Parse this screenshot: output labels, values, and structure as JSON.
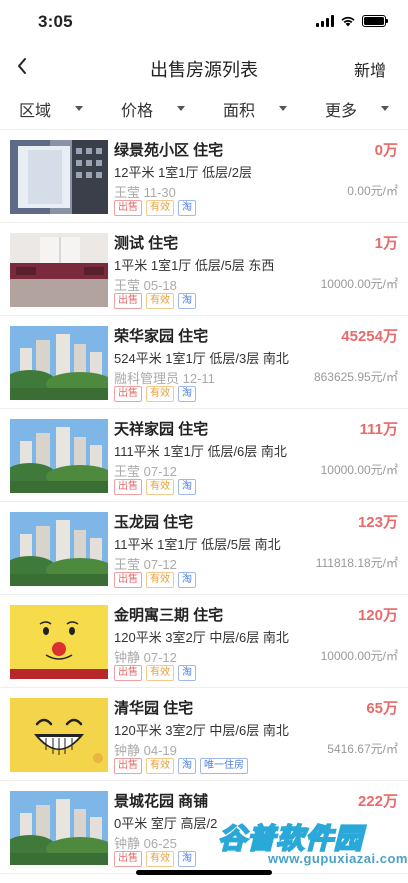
{
  "status": {
    "time": "3:05"
  },
  "nav": {
    "title": "出售房源列表",
    "action": "新增"
  },
  "filters": [
    "区域",
    "价格",
    "面积",
    "更多"
  ],
  "listings": [
    {
      "title": "绿景苑小区 住宅",
      "price": "0万",
      "spec": "12平米 1室1厅 低层/2层",
      "agent": "王莹 11-30",
      "unit_price": "0.00元/㎡",
      "tags": [
        "出售",
        "有效",
        "淘"
      ],
      "thumb": "room-photo"
    },
    {
      "title": "测试 住宅",
      "price": "1万",
      "spec": "1平米 1室1厅 低层/5层 东西",
      "agent": "王莹 05-18",
      "unit_price": "10000.00元/㎡",
      "tags": [
        "出售",
        "有效",
        "淘"
      ],
      "thumb": "interior-photo"
    },
    {
      "title": "荣华家园 住宅",
      "price": "45254万",
      "spec": "524平米 1室1厅 低层/3层 南北",
      "agent": "融科管理员 12-11",
      "unit_price": "863625.95元/㎡",
      "tags": [
        "出售",
        "有效",
        "淘"
      ],
      "thumb": "building-photo"
    },
    {
      "title": "天祥家园 住宅",
      "price": "111万",
      "spec": "111平米 1室1厅 低层/6层 南北",
      "agent": "王莹 07-12",
      "unit_price": "10000.00元/㎡",
      "tags": [
        "出售",
        "有效",
        "淘"
      ],
      "thumb": "building-photo"
    },
    {
      "title": "玉龙园 住宅",
      "price": "123万",
      "spec": "11平米 1室1厅 低层/5层 南北",
      "agent": "王莹 07-12",
      "unit_price": "111818.18元/㎡",
      "tags": [
        "出售",
        "有效",
        "淘"
      ],
      "thumb": "building-photo"
    },
    {
      "title": "金明寓三期 住宅",
      "price": "120万",
      "spec": "120平米 3室2厅 中层/6层 南北",
      "agent": "钟静 07-12",
      "unit_price": "10000.00元/㎡",
      "tags": [
        "出售",
        "有效",
        "淘"
      ],
      "thumb": "cartoon-face"
    },
    {
      "title": "清华园 住宅",
      "price": "65万",
      "spec": "120平米 3室2厅 中层/6层 南北",
      "agent": "钟静 04-19",
      "unit_price": "5416.67元/㎡",
      "tags": [
        "出售",
        "有效",
        "淘",
        "唯一住房"
      ],
      "thumb": "grin-face"
    },
    {
      "title": "景城花园 商铺",
      "price": "222万",
      "spec": "0平米 室厅 高层/2",
      "agent": "钟静 06-25",
      "unit_price": "",
      "tags": [
        "出售",
        "有效",
        "淘"
      ],
      "thumb": "building-photo"
    }
  ],
  "watermark": {
    "main": "谷普软件园",
    "sub": "www.gupuxiazai.com"
  },
  "colors": {
    "price": "#e86a6a",
    "tag_sale": "#e86a6a",
    "tag_valid": "#e8a03a",
    "tag_tao": "#4d7ee8"
  }
}
